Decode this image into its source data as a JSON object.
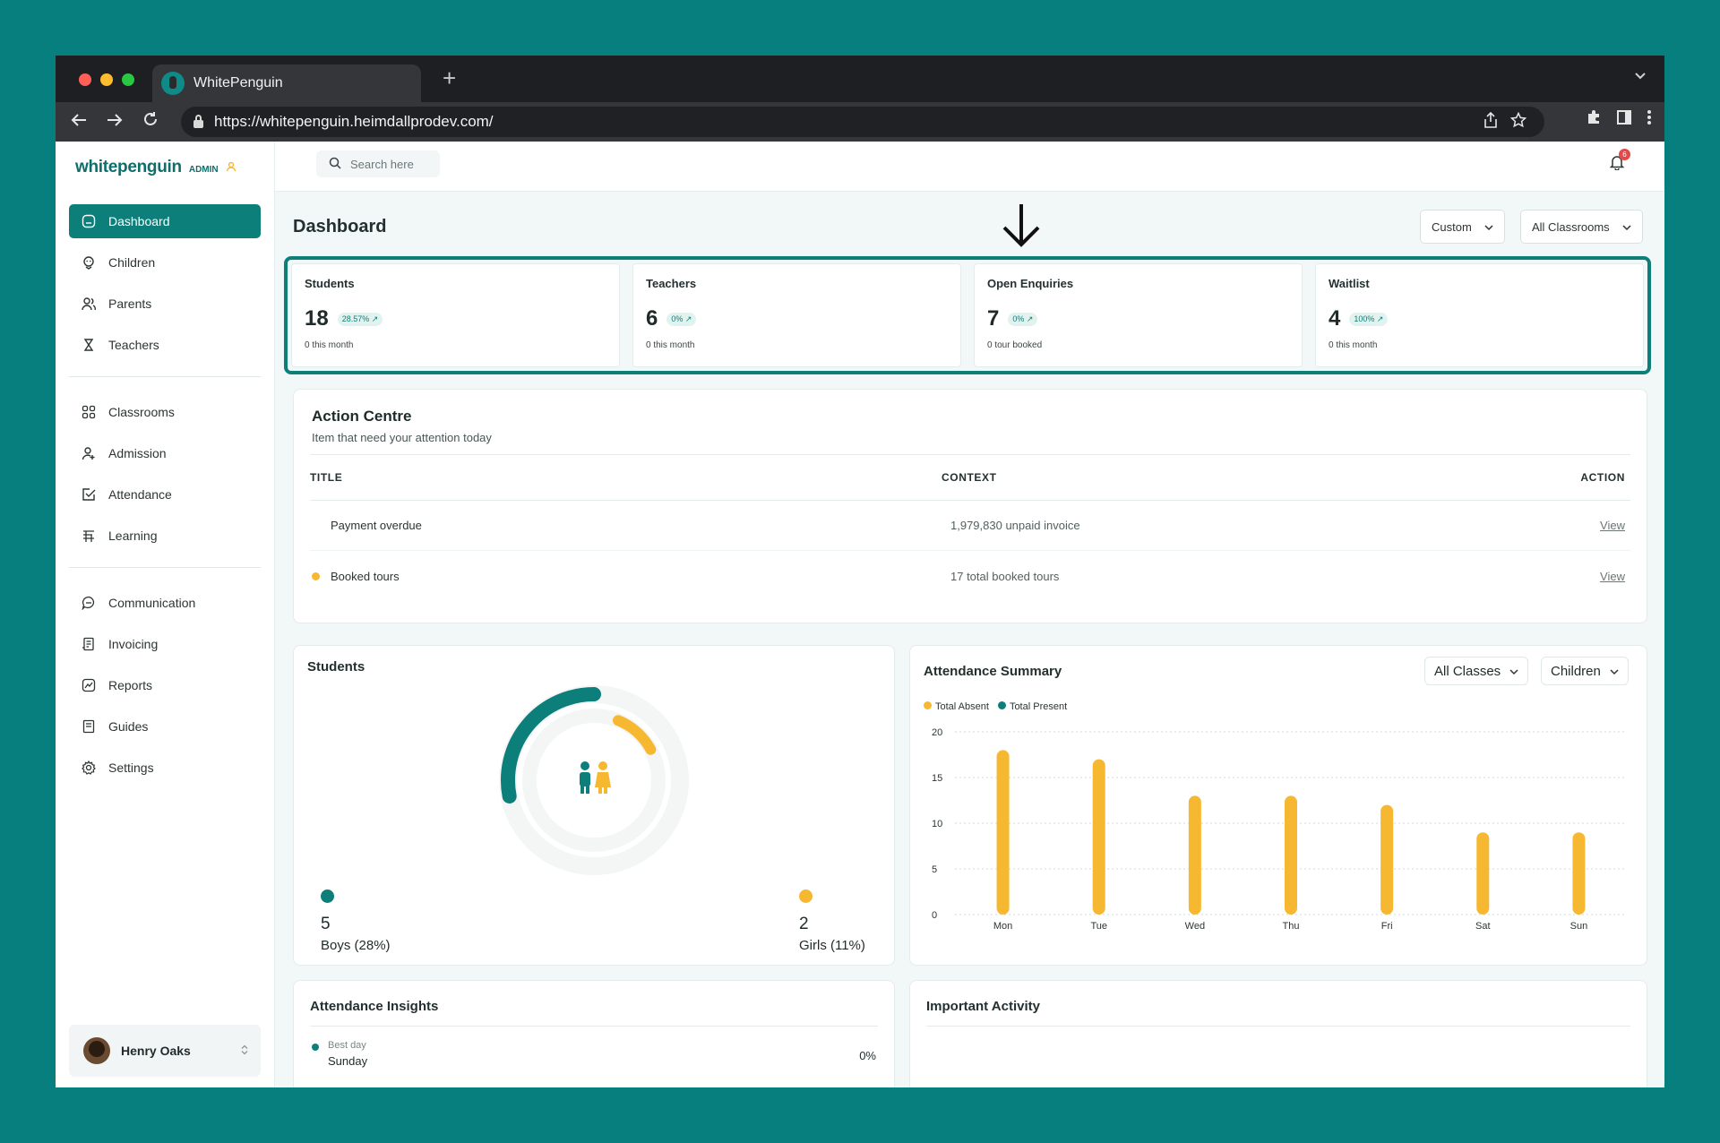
{
  "browser": {
    "tab_title": "WhitePenguin",
    "url": "https://whitepenguin.heimdallprodev.com/",
    "new_tab": "+"
  },
  "sidebar": {
    "logo": "whitepenguin",
    "badge": "ADMIN",
    "items": [
      {
        "label": "Dashboard",
        "icon": "home-icon",
        "active": true
      },
      {
        "label": "Children",
        "icon": "child-icon"
      },
      {
        "label": "Parents",
        "icon": "parents-icon"
      },
      {
        "label": "Teachers",
        "icon": "teacher-icon"
      },
      {
        "label": "Classrooms",
        "icon": "grid-icon"
      },
      {
        "label": "Admission",
        "icon": "user-add-icon"
      },
      {
        "label": "Attendance",
        "icon": "check-icon"
      },
      {
        "label": "Learning",
        "icon": "learning-icon"
      },
      {
        "label": "Communication",
        "icon": "chat-icon"
      },
      {
        "label": "Invoicing",
        "icon": "invoice-icon"
      },
      {
        "label": "Reports",
        "icon": "reports-icon"
      },
      {
        "label": "Guides",
        "icon": "guides-icon"
      },
      {
        "label": "Settings",
        "icon": "gear-icon"
      }
    ],
    "user": "Henry Oaks"
  },
  "topbar": {
    "search_placeholder": "Search here",
    "notif_count": "6"
  },
  "dashboard": {
    "title": "Dashboard",
    "filter_period": "Custom",
    "filter_classrooms": "All Classrooms"
  },
  "stats": [
    {
      "label": "Students",
      "value": "18",
      "change": "28.57% ↗",
      "sub": "0 this month"
    },
    {
      "label": "Teachers",
      "value": "6",
      "change": "0% ↗",
      "sub": "0 this month"
    },
    {
      "label": "Open Enquiries",
      "value": "7",
      "change": "0% ↗",
      "sub": "0 tour booked"
    },
    {
      "label": "Waitlist",
      "value": "4",
      "change": "100% ↗",
      "sub": "0 this month"
    }
  ],
  "action_centre": {
    "title": "Action Centre",
    "subtitle": "Item that need your attention today",
    "headers": [
      "TITLE",
      "CONTEXT",
      "ACTION"
    ],
    "rows": [
      {
        "title": "Payment overdue",
        "context": "1,979,830 unpaid invoice",
        "action": "View",
        "dot": ""
      },
      {
        "title": "Booked tours",
        "context": "17 total booked tours",
        "action": "View",
        "dot": "#f6b830"
      }
    ]
  },
  "students_card": {
    "title": "Students",
    "boys_value": "5",
    "boys_label": "Boys (28%)",
    "girls_value": "2",
    "girls_label": "Girls (11%)",
    "boys_fraction": 0.28,
    "girls_fraction": 0.11
  },
  "attendance_summary": {
    "title": "Attendance Summary",
    "filter_classes": "All Classes",
    "filter_group": "Children"
  },
  "chart_data": {
    "type": "bar",
    "categories": [
      "Mon",
      "Tue",
      "Wed",
      "Thu",
      "Fri",
      "Sat",
      "Sun"
    ],
    "series": [
      {
        "name": "Total Absent",
        "values": [
          18,
          17,
          13,
          13,
          12,
          9,
          9
        ],
        "color": "#f6b830"
      },
      {
        "name": "Total Present",
        "values": [
          0,
          0,
          0,
          0,
          0,
          0,
          0
        ],
        "color": "#0c7f7b"
      }
    ],
    "yticks": [
      0,
      5,
      10,
      15,
      20
    ],
    "ylim": [
      0,
      20
    ],
    "grid": true,
    "legend": "top-left"
  },
  "attendance_insights": {
    "title": "Attendance Insights",
    "best_day_label": "Best day",
    "best_day": "Sunday",
    "best_day_value": "0%"
  },
  "important_activity": {
    "title": "Important Activity"
  },
  "colors": {
    "brand": "#0c7f7b",
    "accent": "#f6b830",
    "background": "#087f7f"
  }
}
